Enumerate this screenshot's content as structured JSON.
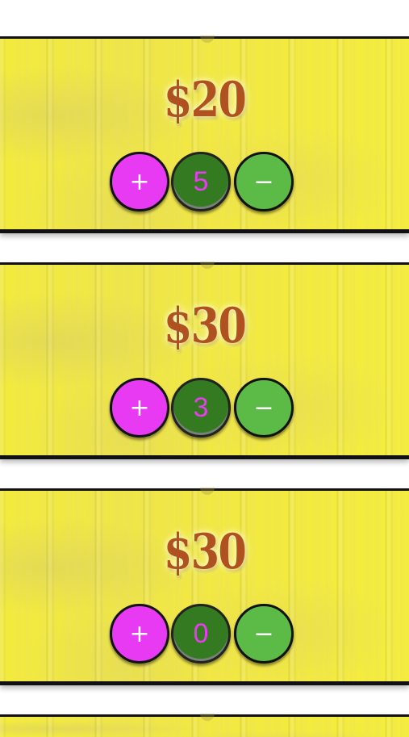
{
  "items": [
    {
      "price": "$20",
      "quantity": "5",
      "plus_label": "+",
      "minus_label": "−"
    },
    {
      "price": "$30",
      "quantity": "3",
      "plus_label": "+",
      "minus_label": "−"
    },
    {
      "price": "$30",
      "quantity": "0",
      "plus_label": "+",
      "minus_label": "−"
    }
  ],
  "colors": {
    "card_background": "#f2ea3c",
    "price_text": "#b0521f",
    "plus_button": "#e93af3",
    "quantity_badge": "#337a20",
    "quantity_text": "#e83cf0",
    "minus_button": "#5bbb46"
  },
  "icons": {
    "plus": "plus-icon",
    "minus": "minus-icon"
  }
}
